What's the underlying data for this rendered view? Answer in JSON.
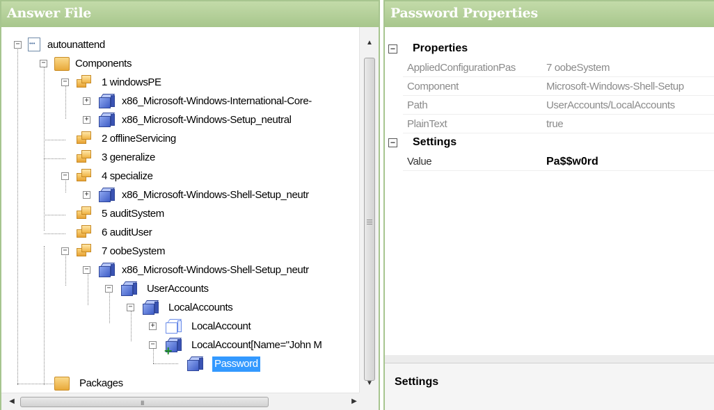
{
  "left_panel": {
    "title": "Answer File"
  },
  "right_panel": {
    "title": "Password Properties"
  },
  "tree": {
    "root": "autounattend",
    "components": "Components",
    "pass1": "1 windowsPE",
    "pass1_child1": "x86_Microsoft-Windows-International-Core-",
    "pass1_child2": "x86_Microsoft-Windows-Setup_neutral",
    "pass2": "2 offlineServicing",
    "pass3": "3 generalize",
    "pass4": "4 specialize",
    "pass4_child1": "x86_Microsoft-Windows-Shell-Setup_neutr",
    "pass5": "5 auditSystem",
    "pass6": "6 auditUser",
    "pass7": "7 oobeSystem",
    "pass7_child1": "x86_Microsoft-Windows-Shell-Setup_neutr",
    "user_accounts": "UserAccounts",
    "local_accounts": "LocalAccounts",
    "local_account": "LocalAccount",
    "local_account_named": "LocalAccount[Name=\"John M",
    "password": "Password",
    "packages": "Packages",
    "selected": "Password"
  },
  "properties": {
    "category1": "Properties",
    "rows": [
      {
        "name": "AppliedConfigurationPas",
        "value": "7 oobeSystem"
      },
      {
        "name": "Component",
        "value": "Microsoft-Windows-Shell-Setup"
      },
      {
        "name": "Path",
        "value": "UserAccounts/LocalAccounts"
      },
      {
        "name": "PlainText",
        "value": "true"
      }
    ],
    "category2": "Settings",
    "setting_rows": [
      {
        "name": "Value",
        "value": "Pa$$w0rd"
      }
    ]
  },
  "description": {
    "title": "Settings"
  },
  "scrollbar": {
    "hgrip": "III"
  },
  "icons": {
    "expander_expanded": "minus",
    "expander_collapsed": "plus",
    "scroll_up": "arrow-up",
    "scroll_down": "arrow-down",
    "scroll_left": "arrow-left",
    "scroll_right": "arrow-right"
  },
  "colors": {
    "header_green": "#a7c68c",
    "selection": "#3399ff",
    "cube_blue": "#3f5dc6",
    "folder_yellow": "#e8a93a"
  }
}
